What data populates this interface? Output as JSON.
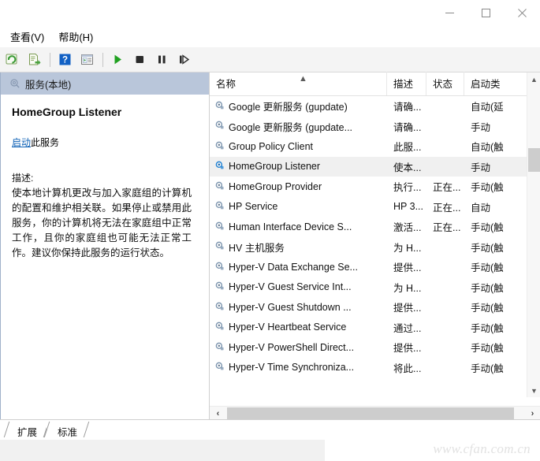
{
  "window": {
    "controls": [
      {
        "name": "minimize",
        "glyph": "minimize-icon"
      },
      {
        "name": "maximize",
        "glyph": "maximize-icon"
      },
      {
        "name": "close",
        "glyph": "close-icon"
      }
    ]
  },
  "menubar": {
    "items": [
      {
        "label": "查看(V)"
      },
      {
        "label": "帮助(H)"
      }
    ]
  },
  "toolbar": {
    "buttons": [
      {
        "name": "refresh-icon",
        "title": "刷新"
      },
      {
        "name": "export-list-icon",
        "title": "导出列表"
      },
      {
        "name": "help-icon",
        "title": "帮助"
      },
      {
        "name": "properties-icon",
        "title": "属性"
      },
      {
        "name": "start-service-icon",
        "title": "启动服务"
      },
      {
        "name": "stop-service-icon",
        "title": "停止服务"
      },
      {
        "name": "pause-service-icon",
        "title": "暂停服务"
      },
      {
        "name": "restart-service-icon",
        "title": "重启服务"
      }
    ]
  },
  "left_pane": {
    "header": "服务(本地)",
    "service_title": "HomeGroup Listener",
    "action_link": "启动",
    "action_suffix": "此服务",
    "description_label": "描述:",
    "description_text": "使本地计算机更改与加入家庭组的计算机的配置和维护相关联。如果停止或禁用此服务，你的计算机将无法在家庭组中正常工作，且你的家庭组也可能无法正常工作。建议你保持此服务的运行状态。"
  },
  "list_view": {
    "columns": [
      {
        "key": "name",
        "label": "名称",
        "sorted": "asc"
      },
      {
        "key": "description",
        "label": "描述"
      },
      {
        "key": "status",
        "label": "状态"
      },
      {
        "key": "startup",
        "label": "启动类"
      }
    ],
    "rows": [
      {
        "name": "Google 更新服务 (gupdate)",
        "description": "请确...",
        "status": "",
        "startup": "自动(延",
        "selected": false
      },
      {
        "name": "Google 更新服务 (gupdate...",
        "description": "请确...",
        "status": "",
        "startup": "手动",
        "selected": false
      },
      {
        "name": "Group Policy Client",
        "description": "此服...",
        "status": "",
        "startup": "自动(触",
        "selected": false
      },
      {
        "name": "HomeGroup Listener",
        "description": "使本...",
        "status": "",
        "startup": "手动",
        "selected": true
      },
      {
        "name": "HomeGroup Provider",
        "description": "执行...",
        "status": "正在...",
        "startup": "手动(触",
        "selected": false
      },
      {
        "name": "HP Service",
        "description": "HP 3...",
        "status": "正在...",
        "startup": "自动",
        "selected": false
      },
      {
        "name": "Human Interface Device S...",
        "description": "激活...",
        "status": "正在...",
        "startup": "手动(触",
        "selected": false
      },
      {
        "name": "HV 主机服务",
        "description": "为 H...",
        "status": "",
        "startup": "手动(触",
        "selected": false
      },
      {
        "name": "Hyper-V Data Exchange Se...",
        "description": "提供...",
        "status": "",
        "startup": "手动(触",
        "selected": false
      },
      {
        "name": "Hyper-V Guest Service Int...",
        "description": "为 H...",
        "status": "",
        "startup": "手动(触",
        "selected": false
      },
      {
        "name": "Hyper-V Guest Shutdown ...",
        "description": "提供...",
        "status": "",
        "startup": "手动(触",
        "selected": false
      },
      {
        "name": "Hyper-V Heartbeat Service",
        "description": "通过...",
        "status": "",
        "startup": "手动(触",
        "selected": false
      },
      {
        "name": "Hyper-V PowerShell Direct...",
        "description": "提供...",
        "status": "",
        "startup": "手动(触",
        "selected": false
      },
      {
        "name": "Hyper-V Time Synchroniza...",
        "description": "将此...",
        "status": "",
        "startup": "手动(触",
        "selected": false
      }
    ]
  },
  "tabs": [
    {
      "label": "扩展"
    },
    {
      "label": "标准"
    }
  ],
  "watermark": "www.cfan.com.cn",
  "colors": {
    "pane_header_blue": "#b9c6da",
    "link_blue": "#0b5fb5",
    "selection_gray": "#f0f0f0",
    "toolbar_bg": "#f4f4f4",
    "scrollbar_thumb": "#cdcdcd"
  }
}
